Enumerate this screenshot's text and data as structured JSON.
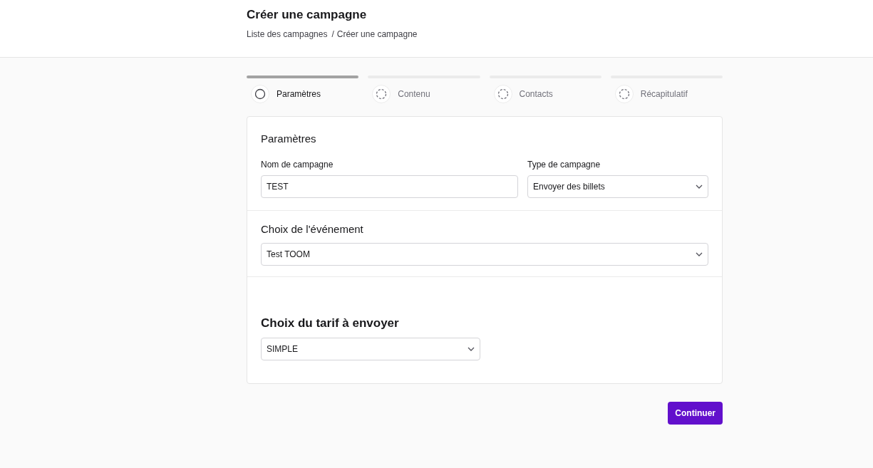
{
  "header": {
    "title": "Créer une campagne",
    "breadcrumb": {
      "link": "Liste des campagnes",
      "separator": "/",
      "current": "Créer une campagne"
    }
  },
  "steps": [
    {
      "label": "Paramètres",
      "selected": true
    },
    {
      "label": "Contenu",
      "selected": false
    },
    {
      "label": "Contacts",
      "selected": false
    },
    {
      "label": "Récapitulatif",
      "selected": false
    }
  ],
  "settings": {
    "title": "Paramètres",
    "name_field": {
      "label": "Nom de campagne",
      "value": "TEST"
    },
    "type_field": {
      "label": "Type de campagne",
      "value": "Envoyer des billets"
    }
  },
  "event": {
    "title": "Choix de l'événement",
    "value": "Test TOOM"
  },
  "rate": {
    "title": "Choix du tarif à envoyer",
    "value": "SIMPLE"
  },
  "continue_button": "Continuer"
}
